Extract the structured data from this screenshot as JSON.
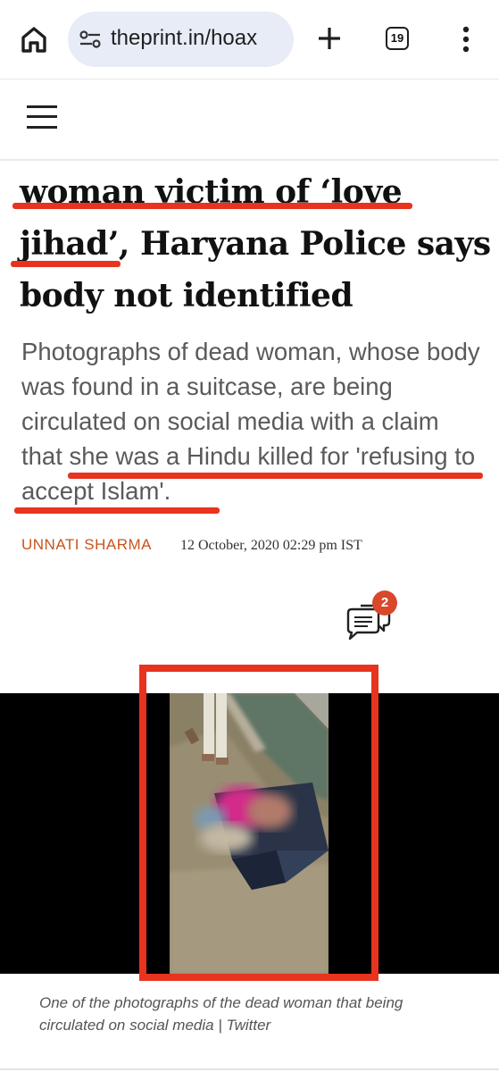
{
  "browser": {
    "url": "theprint.in/hoax",
    "tab_count": "19",
    "icons": [
      "home-icon",
      "site-settings-icon",
      "new-tab-plus-icon",
      "tab-switcher-icon",
      "overflow-menu-icon"
    ]
  },
  "site": {
    "menu_icon": "hamburger-menu-icon"
  },
  "article": {
    "headline_line1": "woman victim of ‘love",
    "headline_line2_a": "jihad’",
    "headline_line2_b": ", Haryana Police says",
    "headline_line3": "body not identified",
    "summary_a": "Photographs of dead woman, whose body was found in a suitcase, are being circulated on social media with a claim that ",
    "summary_b": "she was a Hindu killed for 'refusing to accept Islam'",
    "summary_c": ".",
    "author": "UNNATI SHARMA",
    "date": "12 October, 2020 02:29 pm IST",
    "comment_count": "2",
    "caption": "One of the photographs of the dead woman that being circulated on social media | Twitter"
  },
  "colors": {
    "highlight_red": "#e8331e",
    "author_orange": "#c8541c",
    "badge_red": "#d9482b",
    "url_pill": "#e8ecf7"
  }
}
